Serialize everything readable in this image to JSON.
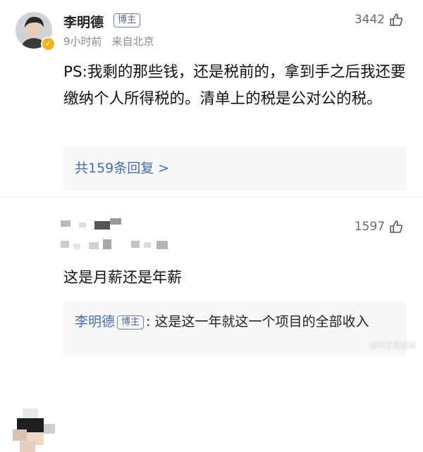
{
  "comments": [
    {
      "author": "李明德",
      "author_tag": "博主",
      "time": "9小时前",
      "location": "来自北京",
      "likes": "3442",
      "text": "PS:我剩的那些钱，还是税前的，拿到手之后我还要缴纳个人所得税的。清单上的税是公对公的税。",
      "replies_label": "共159条回复 >"
    },
    {
      "likes": "1597",
      "text": "这是月薪还是年薪",
      "reply": {
        "author": "李明德",
        "author_tag": "博主",
        "separator": ": ",
        "text": "这是这一年就这一个项目的全部收入"
      }
    }
  ],
  "icons": {
    "like": "thumbs-up-icon",
    "verified": "verified-badge-icon"
  },
  "watermark": "@韩王任建设"
}
